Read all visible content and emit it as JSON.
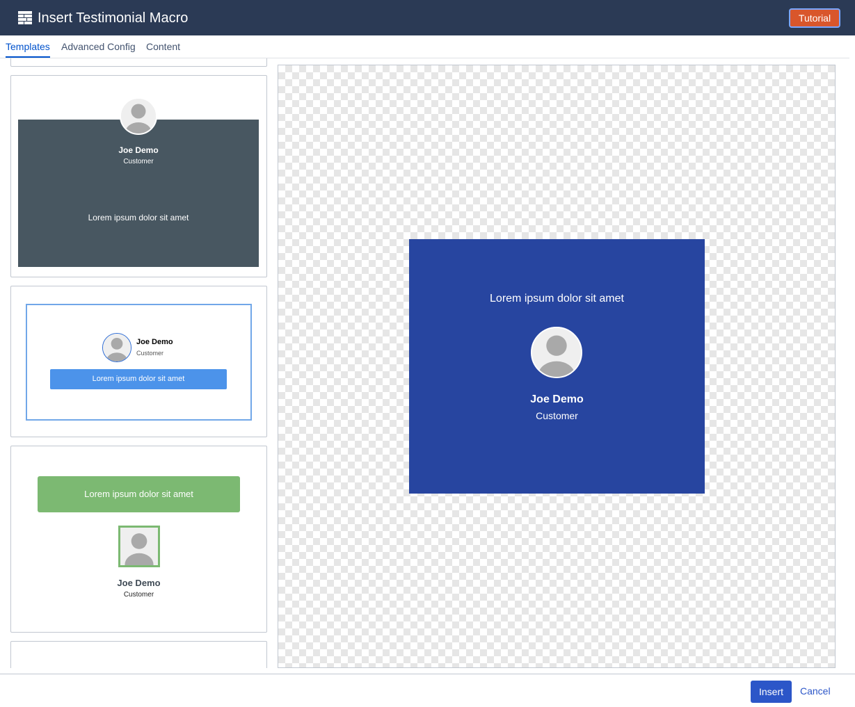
{
  "header": {
    "title": "Insert Testimonial Macro",
    "icon": "table-icon",
    "tutorial_label": "Tutorial"
  },
  "tabs": [
    {
      "label": "Templates",
      "active": true
    },
    {
      "label": "Advanced Config",
      "active": false
    },
    {
      "label": "Content",
      "active": false
    }
  ],
  "templates": [
    {
      "name": "Joe Demo",
      "role": "Customer",
      "quote": "Lorem ipsum dolor sit amet",
      "background": "#485761"
    },
    {
      "name": "Joe Demo",
      "role": "Customer",
      "quote": "Lorem ipsum dolor sit amet",
      "accent": "#4c93ea"
    },
    {
      "name": "Joe Demo",
      "role": "Customer",
      "quote": "Lorem ipsum dolor sit amet",
      "accent": "#7cb972"
    }
  ],
  "preview": {
    "quote": "Lorem ipsum dolor sit amet",
    "name": "Joe Demo",
    "role": "Customer",
    "background": "#2745a0"
  },
  "footer": {
    "insert_label": "Insert",
    "cancel_label": "Cancel"
  }
}
